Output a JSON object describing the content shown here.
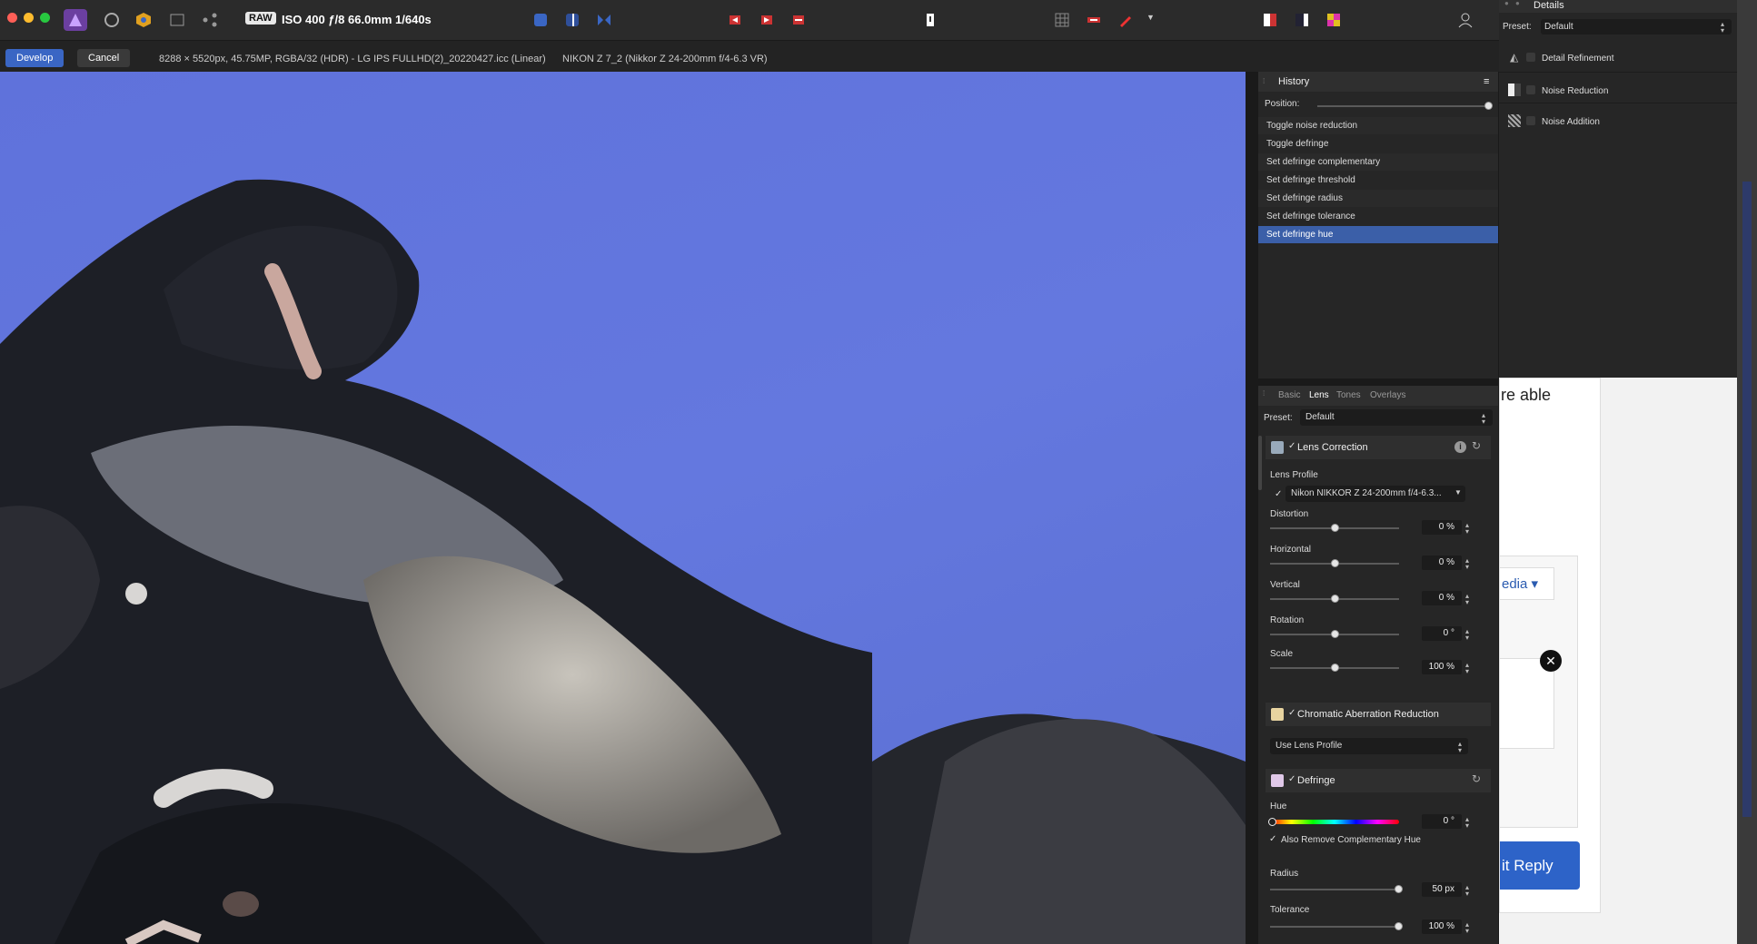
{
  "toolbar": {
    "raw_badge": "RAW",
    "camera_info": "ISO 400 ƒ/8 66.0mm 1/640s"
  },
  "persona": {
    "develop": "Develop",
    "cancel": "Cancel"
  },
  "info": {
    "image": "8288 × 5520px, 45.75MP, RGBA/32 (HDR) - LG IPS FULLHD(2)_20220427.icc (Linear)",
    "lens": "NIKON Z 7_2 (Nikkor Z 24-200mm f/4-6.3 VR)"
  },
  "history": {
    "title": "History",
    "position_label": "Position:",
    "items": [
      "Toggle noise reduction",
      "Toggle defringe",
      "Set defringe complementary",
      "Set defringe threshold",
      "Set defringe radius",
      "Set defringe tolerance",
      "Set defringe hue"
    ]
  },
  "lens": {
    "tabs": [
      "Basic",
      "Lens",
      "Tones",
      "Overlays"
    ],
    "preset_label": "Preset:",
    "preset_value": "Default",
    "lens_correction": "Lens Correction",
    "lens_profile_label": "Lens Profile",
    "lens_profile_value": "Nikon NIKKOR Z 24-200mm f/4-6.3...",
    "sliders": [
      {
        "label": "Distortion",
        "value": "0 %",
        "pos": 0.5
      },
      {
        "label": "Horizontal",
        "value": "0 %",
        "pos": 0.5
      },
      {
        "label": "Vertical",
        "value": "0 %",
        "pos": 0.5
      },
      {
        "label": "Rotation",
        "value": "0 °",
        "pos": 0.5
      },
      {
        "label": "Scale",
        "value": "100 %",
        "pos": 0.5
      }
    ],
    "chromatic": "Chromatic Aberration Reduction",
    "use_profile": "Use Lens Profile",
    "defringe": "Defringe",
    "hue_label": "Hue",
    "hue_value": "0 °",
    "also_remove": "Also Remove Complementary Hue",
    "radius_label": "Radius",
    "radius_value": "50 px",
    "tolerance_label": "Tolerance",
    "tolerance_value": "100 %"
  },
  "details": {
    "title": "Details",
    "preset_label": "Preset:",
    "preset_value": "Default",
    "items": [
      "Detail Refinement",
      "Noise Reduction",
      "Noise Addition"
    ]
  },
  "web": {
    "text_fragment": "re able",
    "dropdown_fragment": "edia ▾",
    "submit_fragment": "it Reply"
  },
  "colors": {
    "accent": "#3a66c4",
    "sky": "#6478df",
    "selected": "#3b5fa8"
  }
}
